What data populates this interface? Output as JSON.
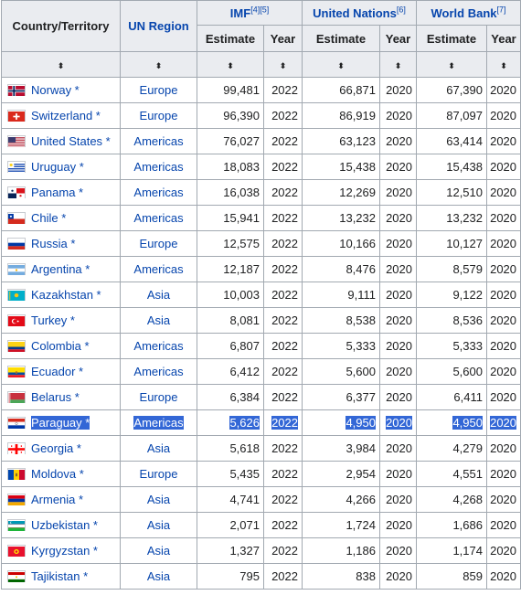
{
  "headers": {
    "country": "Country/Territory",
    "region": "UN Region",
    "imf": "IMF",
    "imf_refs": "[4][5]",
    "un": "United Nations",
    "un_refs": "[6]",
    "wb": "World Bank",
    "wb_refs": "[7]",
    "estimate": "Estimate",
    "year": "Year",
    "sort_glyph": "⬍"
  },
  "rows": [
    {
      "country": "Norway *",
      "region": "Europe",
      "imf": "99,481",
      "imf_year": "2022",
      "un": "66,871",
      "un_year": "2020",
      "wb": "67,390",
      "wb_year": "2020",
      "flag": "norway-flag-icon",
      "colors": [
        "#ba0c2f",
        "#ffffff",
        "#00205b"
      ]
    },
    {
      "country": "Switzerland *",
      "region": "Europe",
      "imf": "96,390",
      "imf_year": "2022",
      "un": "86,919",
      "un_year": "2020",
      "wb": "87,097",
      "wb_year": "2020",
      "flag": "switzerland-flag-icon",
      "colors": [
        "#da291c",
        "#ffffff"
      ]
    },
    {
      "country": "United States *",
      "region": "Americas",
      "imf": "76,027",
      "imf_year": "2022",
      "un": "63,123",
      "un_year": "2020",
      "wb": "63,414",
      "wb_year": "2020",
      "flag": "united-states-flag-icon",
      "colors": [
        "#b22234",
        "#ffffff",
        "#3c3b6e"
      ]
    },
    {
      "country": "Uruguay *",
      "region": "Americas",
      "imf": "18,083",
      "imf_year": "2022",
      "un": "15,438",
      "un_year": "2020",
      "wb": "15,438",
      "wb_year": "2020",
      "flag": "uruguay-flag-icon",
      "colors": [
        "#0038a8",
        "#ffffff",
        "#fcd116"
      ]
    },
    {
      "country": "Panama *",
      "region": "Americas",
      "imf": "16,038",
      "imf_year": "2022",
      "un": "12,269",
      "un_year": "2020",
      "wb": "12,510",
      "wb_year": "2020",
      "flag": "panama-flag-icon",
      "colors": [
        "#da121a",
        "#ffffff",
        "#072357"
      ]
    },
    {
      "country": "Chile *",
      "region": "Americas",
      "imf": "15,941",
      "imf_year": "2022",
      "un": "13,232",
      "un_year": "2020",
      "wb": "13,232",
      "wb_year": "2020",
      "flag": "chile-flag-icon",
      "colors": [
        "#d52b1e",
        "#ffffff",
        "#0039a6"
      ]
    },
    {
      "country": "Russia *",
      "region": "Europe",
      "imf": "12,575",
      "imf_year": "2022",
      "un": "10,166",
      "un_year": "2020",
      "wb": "10,127",
      "wb_year": "2020",
      "flag": "russia-flag-icon",
      "colors": [
        "#ffffff",
        "#0039a6",
        "#d52b1e"
      ]
    },
    {
      "country": "Argentina *",
      "region": "Americas",
      "imf": "12,187",
      "imf_year": "2022",
      "un": "8,476",
      "un_year": "2020",
      "wb": "8,579",
      "wb_year": "2020",
      "flag": "argentina-flag-icon",
      "colors": [
        "#74acdf",
        "#ffffff",
        "#f6b40e"
      ]
    },
    {
      "country": "Kazakhstan *",
      "region": "Asia",
      "imf": "10,003",
      "imf_year": "2022",
      "un": "9,111",
      "un_year": "2020",
      "wb": "9,122",
      "wb_year": "2020",
      "flag": "kazakhstan-flag-icon",
      "colors": [
        "#00afca",
        "#fec50c"
      ]
    },
    {
      "country": "Turkey *",
      "region": "Asia",
      "imf": "8,081",
      "imf_year": "2022",
      "un": "8,538",
      "un_year": "2020",
      "wb": "8,536",
      "wb_year": "2020",
      "flag": "turkey-flag-icon",
      "colors": [
        "#e30a17",
        "#ffffff"
      ]
    },
    {
      "country": "Colombia *",
      "region": "Americas",
      "imf": "6,807",
      "imf_year": "2022",
      "un": "5,333",
      "un_year": "2020",
      "wb": "5,333",
      "wb_year": "2020",
      "flag": "colombia-flag-icon",
      "colors": [
        "#fcd116",
        "#003893",
        "#ce1126"
      ]
    },
    {
      "country": "Ecuador *",
      "region": "Americas",
      "imf": "6,412",
      "imf_year": "2022",
      "un": "5,600",
      "un_year": "2020",
      "wb": "5,600",
      "wb_year": "2020",
      "flag": "ecuador-flag-icon",
      "colors": [
        "#ffdd00",
        "#034ea2",
        "#ed1c24"
      ]
    },
    {
      "country": "Belarus *",
      "region": "Europe",
      "imf": "6,384",
      "imf_year": "2022",
      "un": "6,377",
      "un_year": "2020",
      "wb": "6,411",
      "wb_year": "2020",
      "flag": "belarus-flag-icon",
      "colors": [
        "#c8313e",
        "#4aa657",
        "#ffffff"
      ]
    },
    {
      "country": "Paraguay *",
      "region": "Americas",
      "imf": "5,626",
      "imf_year": "2022",
      "un": "4,950",
      "un_year": "2020",
      "wb": "4,950",
      "wb_year": "2020",
      "flag": "paraguay-flag-icon",
      "colors": [
        "#d52b1e",
        "#ffffff",
        "#0038a8"
      ],
      "selected": true
    },
    {
      "country": "Georgia *",
      "region": "Asia",
      "imf": "5,618",
      "imf_year": "2022",
      "un": "3,984",
      "un_year": "2020",
      "wb": "4,279",
      "wb_year": "2020",
      "flag": "georgia-flag-icon",
      "colors": [
        "#ffffff",
        "#ff0000"
      ]
    },
    {
      "country": "Moldova *",
      "region": "Europe",
      "imf": "5,435",
      "imf_year": "2022",
      "un": "2,954",
      "un_year": "2020",
      "wb": "4,551",
      "wb_year": "2020",
      "flag": "moldova-flag-icon",
      "colors": [
        "#0046ae",
        "#ffd200",
        "#cc092f"
      ]
    },
    {
      "country": "Armenia *",
      "region": "Asia",
      "imf": "4,741",
      "imf_year": "2022",
      "un": "4,266",
      "un_year": "2020",
      "wb": "4,268",
      "wb_year": "2020",
      "flag": "armenia-flag-icon",
      "colors": [
        "#d90012",
        "#0033a0",
        "#f2a800"
      ]
    },
    {
      "country": "Uzbekistan *",
      "region": "Asia",
      "imf": "2,071",
      "imf_year": "2022",
      "un": "1,724",
      "un_year": "2020",
      "wb": "1,686",
      "wb_year": "2020",
      "flag": "uzbekistan-flag-icon",
      "colors": [
        "#1eb53a",
        "#ffffff",
        "#0099b5"
      ]
    },
    {
      "country": "Kyrgyzstan *",
      "region": "Asia",
      "imf": "1,327",
      "imf_year": "2022",
      "un": "1,186",
      "un_year": "2020",
      "wb": "1,174",
      "wb_year": "2020",
      "flag": "kyrgyzstan-flag-icon",
      "colors": [
        "#e8112d",
        "#ffef00"
      ]
    },
    {
      "country": "Tajikistan *",
      "region": "Asia",
      "imf": "795",
      "imf_year": "2022",
      "un": "838",
      "un_year": "2020",
      "wb": "859",
      "wb_year": "2020",
      "flag": "tajikistan-flag-icon",
      "colors": [
        "#cc0000",
        "#ffffff",
        "#006600"
      ]
    }
  ],
  "colors": {
    "header_bg": "#eaecf0",
    "border": "#a2a9b1",
    "link": "#0645ad",
    "selection": "#3367d6"
  }
}
